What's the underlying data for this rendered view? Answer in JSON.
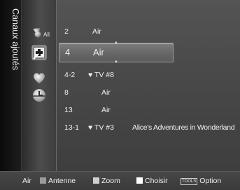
{
  "title": "Canaux ajoutés",
  "icons": [
    {
      "name": "antenna-all-icon",
      "label": "All"
    },
    {
      "name": "add-channel-icon"
    },
    {
      "name": "favorite-heart-icon"
    },
    {
      "name": "clock-timer-icon"
    }
  ],
  "channels": [
    {
      "number": "2",
      "type": "Air",
      "favorite": false,
      "program": ""
    },
    {
      "number": "4",
      "type": "Air",
      "favorite": false,
      "program": "",
      "selected": true
    },
    {
      "number": "4-2",
      "type": "♥ TV #8",
      "favorite": true,
      "program": ""
    },
    {
      "number": "8",
      "type": "Air",
      "favorite": false,
      "program": ""
    },
    {
      "number": "13",
      "type": "Air",
      "favorite": false,
      "program": ""
    },
    {
      "number": "13-1",
      "type": "♥ TV #3",
      "favorite": true,
      "program": "Alice's Adventures in Wonderland"
    }
  ],
  "bottom_bar": {
    "source": "Air",
    "antenna": "Antenne",
    "zoom": "Zoom",
    "select": "Choisir",
    "tools_key": "TOOLS",
    "option": "Option"
  },
  "colors": {
    "heart": "#d9d9d9",
    "selected_row": "#6a6a6a",
    "panel": "#4a4a4a"
  }
}
